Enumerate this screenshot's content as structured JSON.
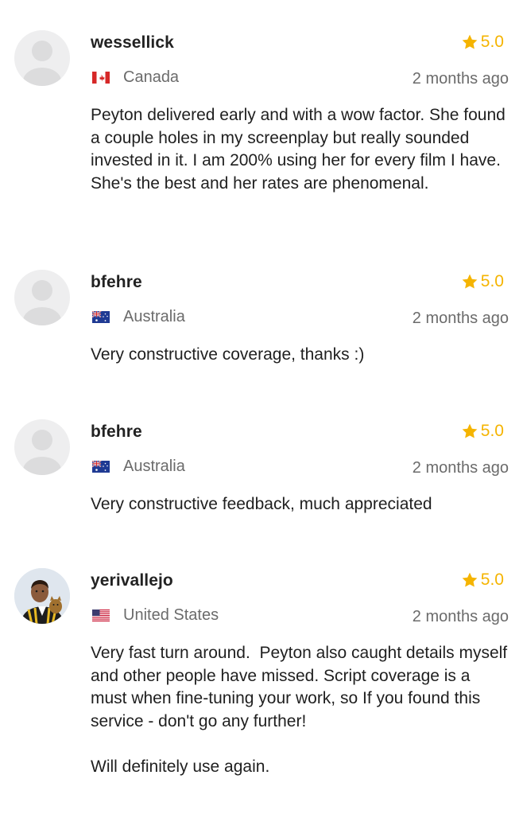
{
  "reviews": [
    {
      "username": "wessellick",
      "rating": "5.0",
      "country": "Canada",
      "flag": "canada-flag-icon",
      "time": "2 months ago",
      "text": "Peyton delivered early and with a wow factor. She found a couple holes in my screenplay but really sounded invested in it. I am 200% using her for every film I have. She's the best and her rates are phenomenal."
    },
    {
      "username": "bfehre",
      "rating": "5.0",
      "country": "Australia",
      "flag": "australia-flag-icon",
      "time": "2 months ago",
      "text": "Very constructive coverage, thanks :)"
    },
    {
      "username": "bfehre",
      "rating": "5.0",
      "country": "Australia",
      "flag": "australia-flag-icon",
      "time": "2 months ago",
      "text": "Very constructive feedback, much appreciated"
    },
    {
      "username": "yerivallejo",
      "rating": "5.0",
      "country": "United States",
      "flag": "us-flag-icon",
      "time": "2 months ago",
      "text": "Very fast turn around.  Peyton also caught details myself and other people have missed. Script coverage is a must when fine-tuning your work, so If you found this service - don't go any further!\n\nWill definitely use again."
    }
  ],
  "colors": {
    "star": "#f5b400",
    "muted": "#6b6b6b",
    "avatar_bg": "#eeeeef"
  }
}
